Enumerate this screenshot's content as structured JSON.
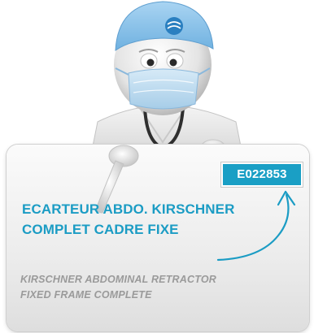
{
  "product": {
    "code": "E022853",
    "name_fr": [
      "ECARTEUR ABDO. KIRSCHNER",
      "COMPLET CADRE FIXE"
    ],
    "name_en": [
      "KIRSCHNER ABDOMINAL RETRACTOR",
      "FIXED FRAME COMPLETE"
    ]
  },
  "colors": {
    "accent": "#1b9cc4",
    "badge_bg": "#1a9fc5",
    "subtitle_text": "#9a9a9a",
    "scrub_cap": "#8cc3e8"
  },
  "icons": {
    "mascot": "doctor-mascot-icon",
    "arrow": "curved-arrow-icon",
    "cap_logo": "brand-logo-icon"
  }
}
